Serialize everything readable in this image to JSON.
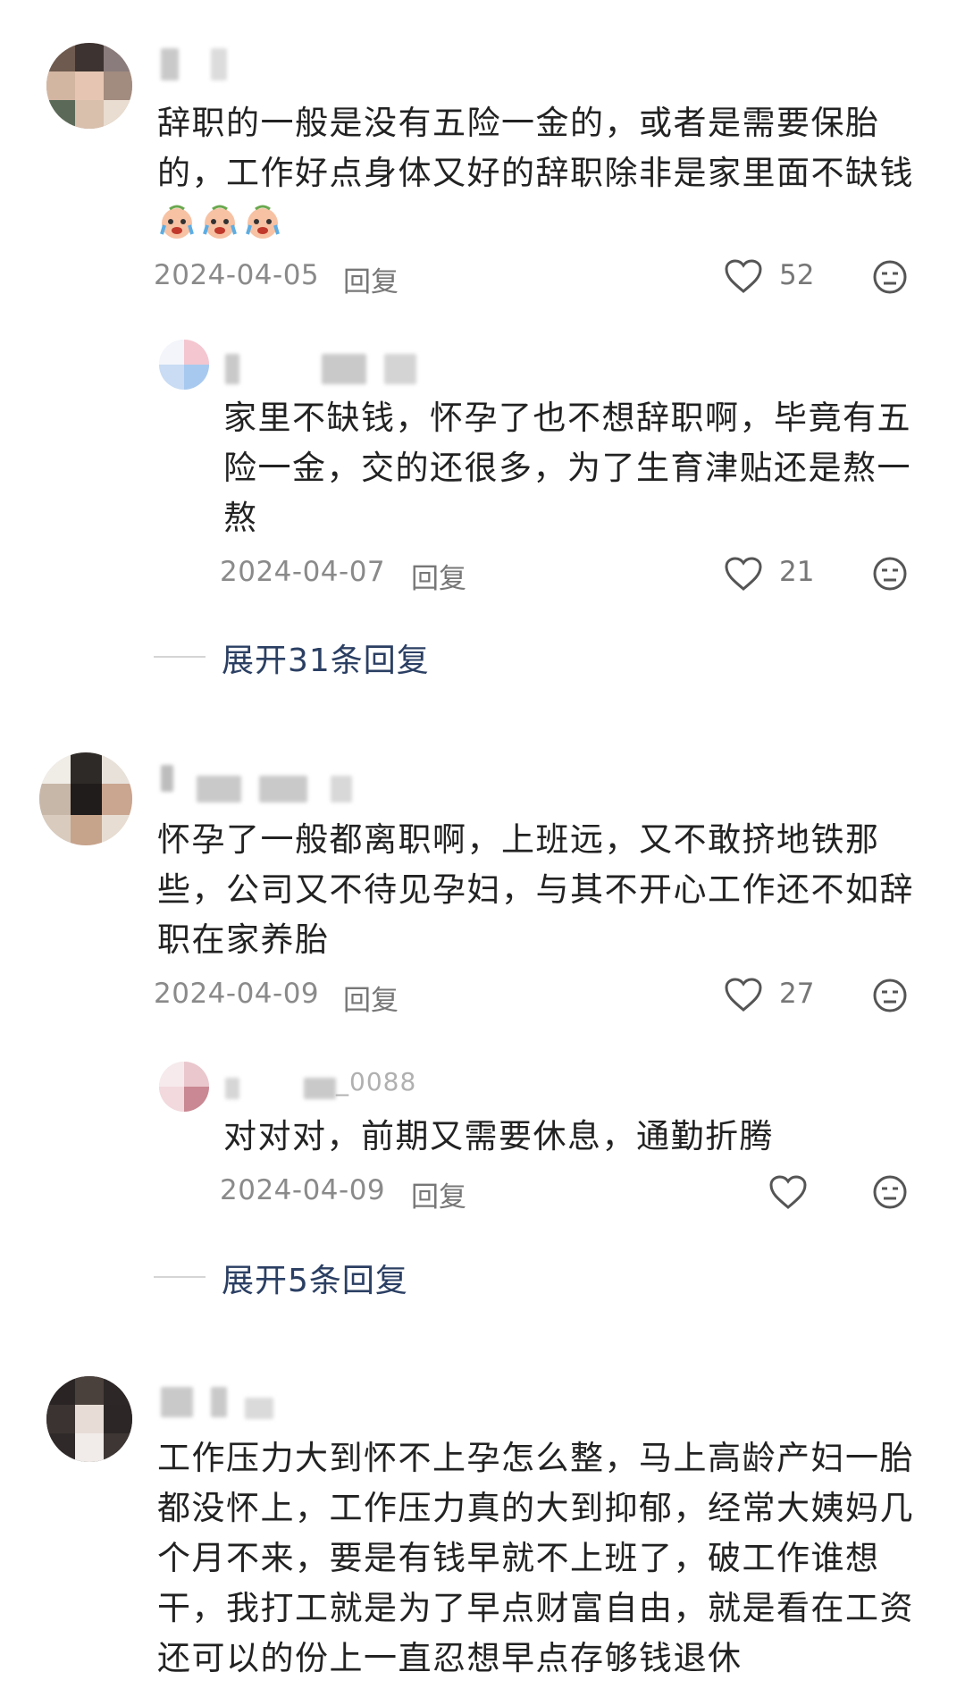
{
  "comments": [
    {
      "text": "辞职的一般是没有五险一金的，或者是需要保胎的，工作好点身体又好的辞职除非是家里面不缺钱",
      "emoji_name": "crying-face-emoji",
      "date": "2024-04-05",
      "reply_label": "回复",
      "likes": "52",
      "replies": [
        {
          "text": "家里不缺钱，怀孕了也不想辞职啊，毕竟有五险一金，交的还很多，为了生育津贴还是熬一熬",
          "date": "2024-04-07",
          "reply_label": "回复",
          "likes": "21"
        }
      ],
      "expand_label": "展开31条回复"
    },
    {
      "text": "怀孕了一般都离职啊，上班远，又不敢挤地铁那些，公司又不待见孕妇，与其不开心工作还不如辞职在家养胎",
      "date": "2024-04-09",
      "reply_label": "回复",
      "likes": "27",
      "replies": [
        {
          "name_partial": "_0088",
          "text": "对对对，前期又需要休息，通勤折腾",
          "date": "2024-04-09",
          "reply_label": "回复",
          "likes": ""
        }
      ],
      "expand_label": "展开5条回复"
    },
    {
      "text": "工作压力大到怀不上孕怎么整，马上高龄产妇一胎都没怀上，工作压力真的大到抑郁，经常大姨妈几个月不来，要是有钱早就不上班了，破工作谁想干，我打工就是为了早点财富自由，就是看在工资还可以的份上一直忍想早点存够钱退休"
    }
  ],
  "colors": {
    "text": "#222222",
    "meta": "#8a8a8a",
    "expand": "#2b3f63",
    "icon": "#555555"
  }
}
